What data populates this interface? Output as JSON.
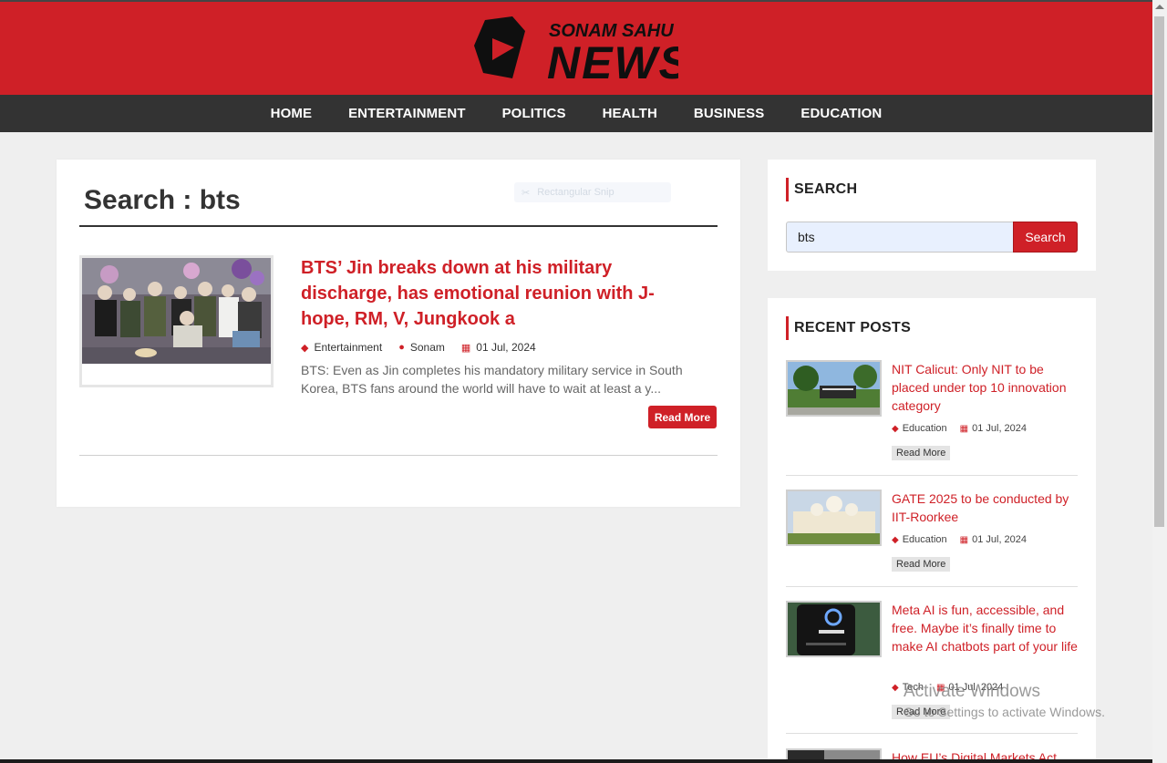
{
  "brand": {
    "logo_line1": "SONAM SAHU",
    "logo_line2": "NEWS",
    "accent": "#cf2027",
    "nav_bg": "#333333"
  },
  "nav": {
    "items": [
      "HOME",
      "ENTERTAINMENT",
      "POLITICS",
      "HEALTH",
      "BUSINESS",
      "EDUCATION"
    ]
  },
  "main": {
    "search_title": "Search : bts",
    "snip_overlay": "Rectangular Snip",
    "post": {
      "title": "BTS’ Jin breaks down at his military discharge, has emotional reunion with J-hope, RM, V, Jungkook a",
      "category": "Entertainment",
      "author": "Sonam",
      "date": "01 Jul, 2024",
      "excerpt": "BTS: Even as Jin completes his mandatory military service in South Korea, BTS fans around the world will have to wait at least a y...",
      "read_more": "Read More"
    }
  },
  "sidebar": {
    "search": {
      "title": "SEARCH",
      "value": "bts",
      "button": "Search"
    },
    "recent": {
      "title": "RECENT POSTS",
      "items": [
        {
          "title": "NIT Calicut: Only NIT to be placed under top 10 innovation category",
          "category": "Education",
          "date": "01 Jul, 2024",
          "read_more": "Read More"
        },
        {
          "title": "GATE 2025 to be conducted by IIT-Roorkee",
          "category": "Education",
          "date": "01 Jul, 2024",
          "read_more": "Read More"
        },
        {
          "title": "Meta AI is fun, accessible, and free. Maybe it’s finally time to make AI chatbots part of your life",
          "category": "Tech",
          "date": "01 Jul, 2024",
          "read_more": "Read More"
        },
        {
          "title": "How EU’s Digital Markets Act"
        }
      ]
    }
  },
  "watermark": {
    "line1": "Activate Windows",
    "line2": "Go to Settings to activate Windows."
  }
}
